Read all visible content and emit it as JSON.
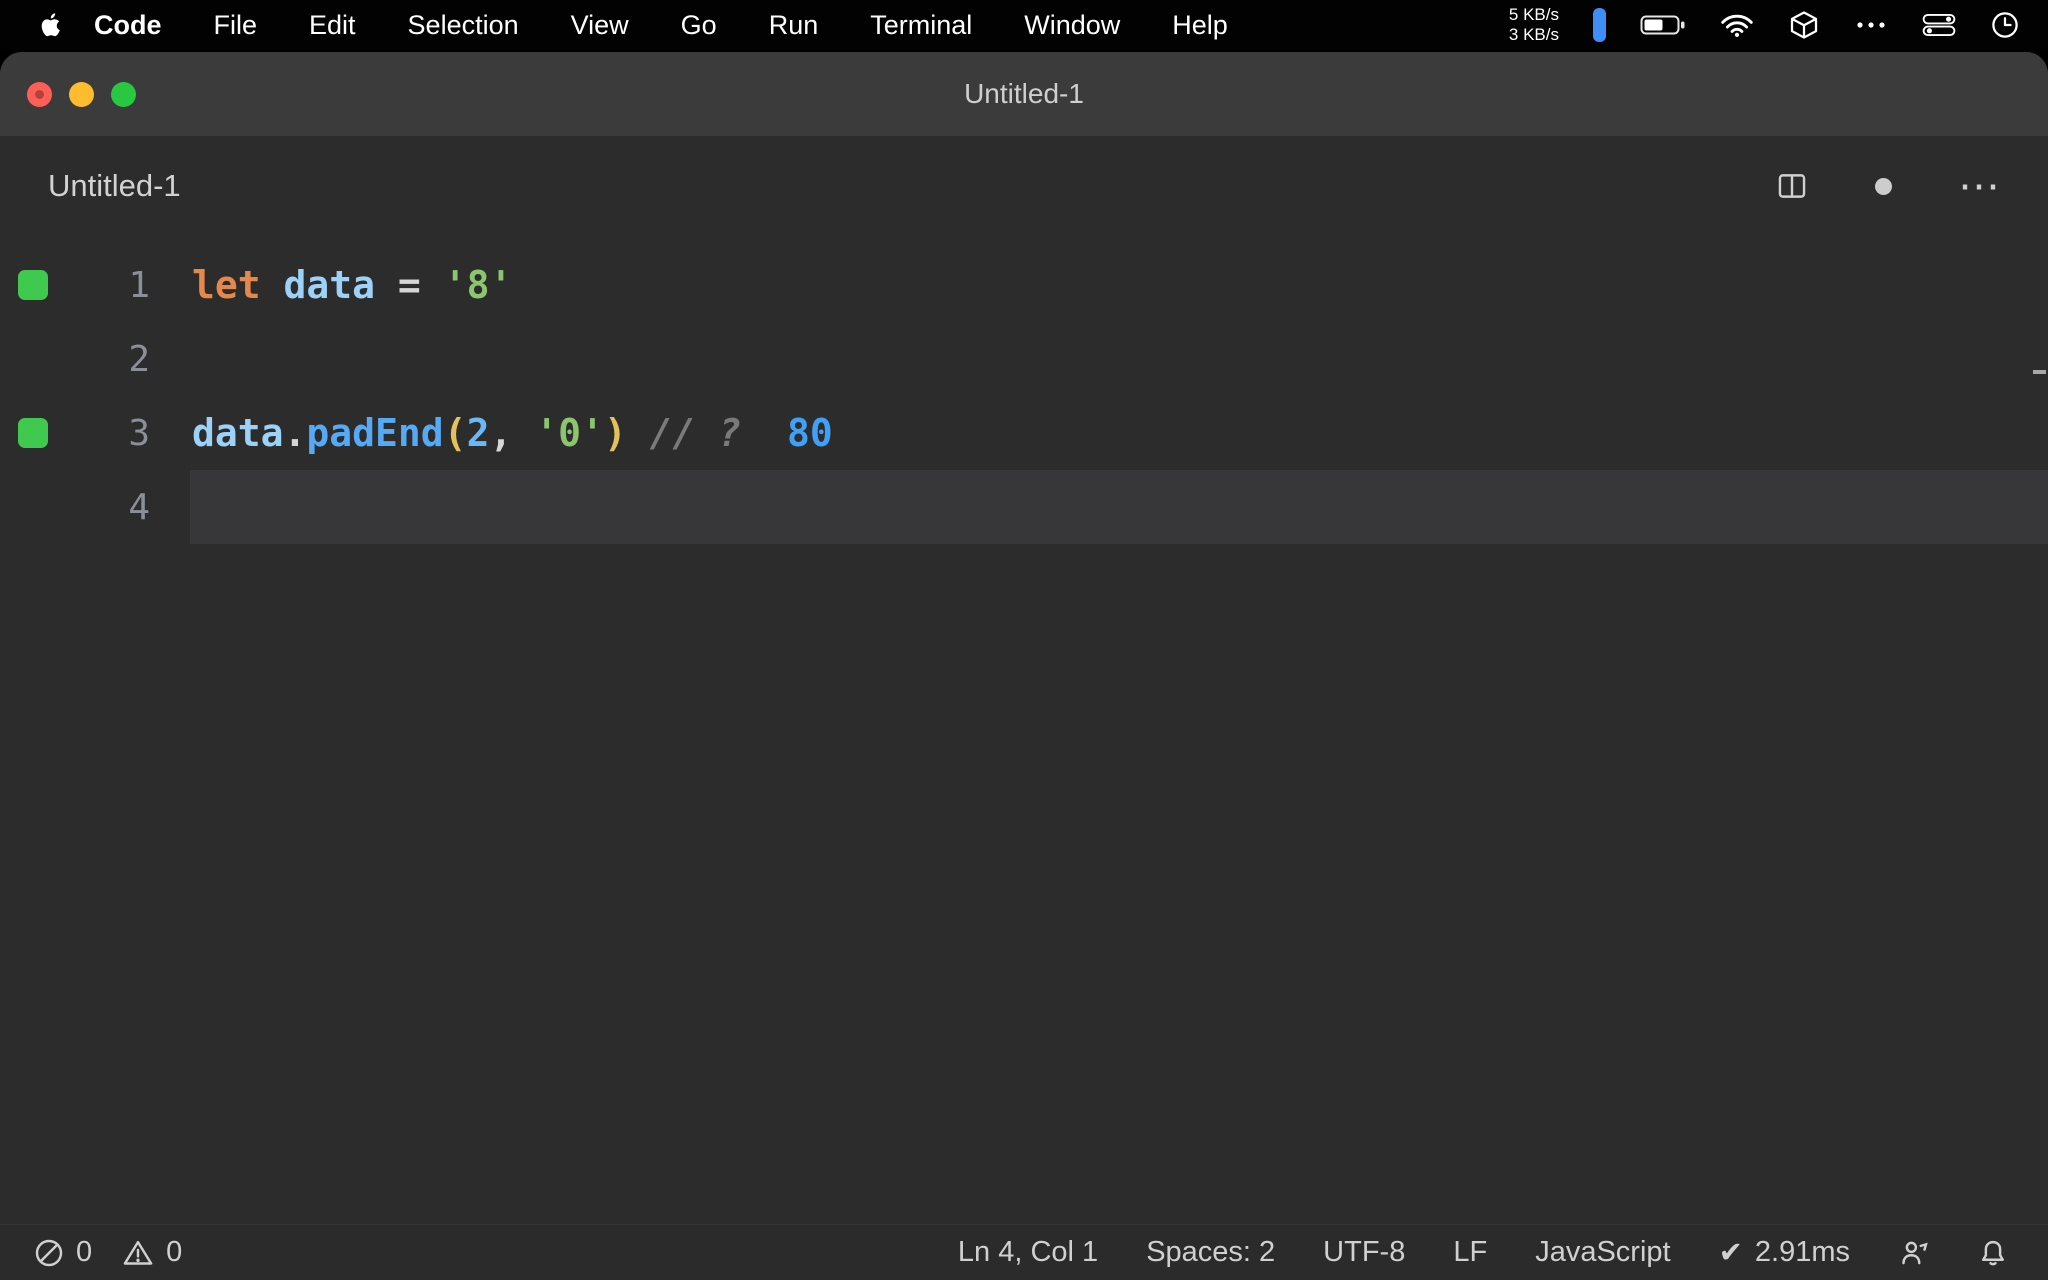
{
  "menubar": {
    "items": [
      "Code",
      "File",
      "Edit",
      "Selection",
      "View",
      "Go",
      "Run",
      "Terminal",
      "Window",
      "Help"
    ],
    "net_up": "5 KB/s",
    "net_down": "3 KB/s"
  },
  "window": {
    "title": "Untitled-1"
  },
  "editor": {
    "tab_title": "Untitled-1",
    "unsaved": true,
    "lines": [
      {
        "number": "1",
        "covered": true,
        "tokens": [
          {
            "text": "let",
            "style": "keyword"
          },
          {
            "text": " ",
            "style": "plain"
          },
          {
            "text": "data",
            "style": "variable"
          },
          {
            "text": " = ",
            "style": "operator"
          },
          {
            "text": "'8'",
            "style": "string"
          }
        ]
      },
      {
        "number": "2",
        "covered": false,
        "tokens": []
      },
      {
        "number": "3",
        "covered": true,
        "tokens": [
          {
            "text": "data",
            "style": "variable"
          },
          {
            "text": ".",
            "style": "operator"
          },
          {
            "text": "padEnd",
            "style": "function"
          },
          {
            "text": "(",
            "style": "bracket"
          },
          {
            "text": "2",
            "style": "number"
          },
          {
            "text": ", ",
            "style": "operator"
          },
          {
            "text": "'0'",
            "style": "string"
          },
          {
            "text": ")",
            "style": "bracket"
          },
          {
            "text": " ",
            "style": "plain"
          },
          {
            "text": "// ?",
            "style": "comment"
          },
          {
            "text": "  ",
            "style": "plain"
          },
          {
            "text": "80",
            "style": "quokka-value"
          }
        ]
      },
      {
        "number": "4",
        "covered": false,
        "current": true,
        "tokens": []
      }
    ]
  },
  "statusbar": {
    "errors": "0",
    "warnings": "0",
    "cursor_position": "Ln 4, Col 1",
    "indentation": "Spaces: 2",
    "encoding": "UTF-8",
    "eol": "LF",
    "language": "JavaScript",
    "quokka_time": "2.91ms"
  },
  "icons": {
    "more_actions": "⋯",
    "check": "✔"
  },
  "colors": {
    "menubar_bg": "#020202",
    "titlebar_bg": "#3b3b3b",
    "editor_bg": "#2c2c2c",
    "current_line_bg": "#373739",
    "statusbar_bg": "#2b2b2b",
    "traffic_red": "#ff5f57",
    "traffic_yellow": "#febc2e",
    "traffic_green": "#28c840",
    "coverage_green": "#3fc94f",
    "keyword_orange": "#e5884c",
    "variable_blue": "#9cd2f7",
    "function_blue": "#56aaf5",
    "string_green": "#8bc56d",
    "bracket_gold": "#e2c25c",
    "number_blue": "#6cb8f6",
    "comment_gray": "#7a7a7a",
    "quokka_value_blue": "#3fa0f6",
    "net_pill_blue": "#3f8ef7"
  }
}
